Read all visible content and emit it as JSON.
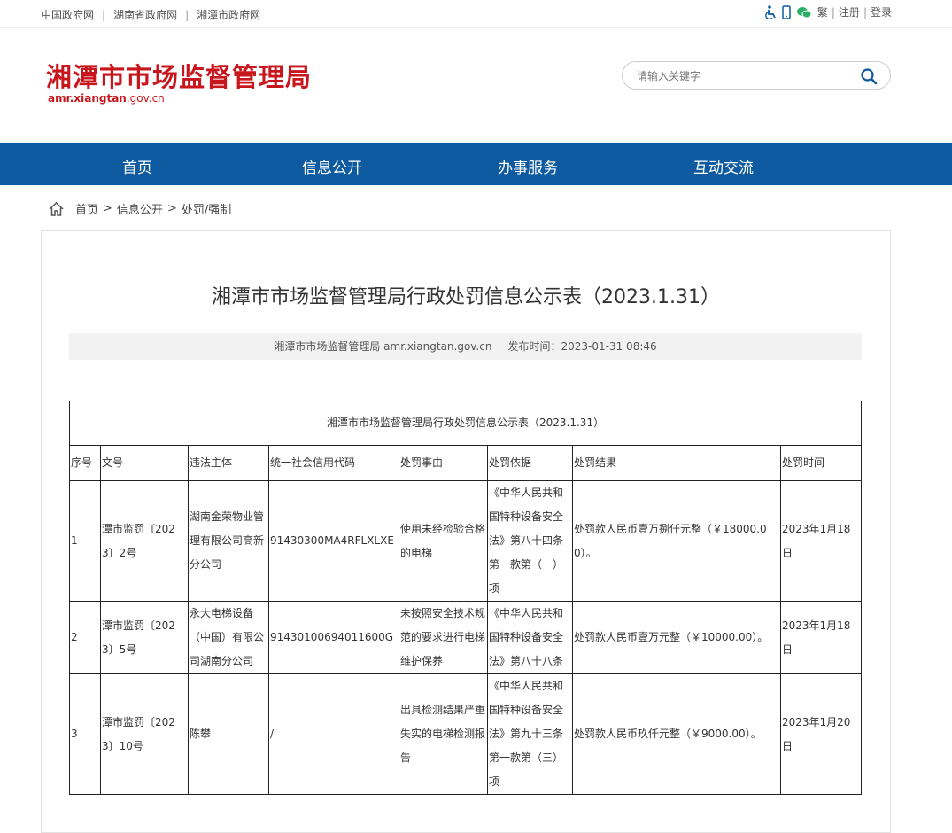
{
  "topbar": {
    "links": [
      "中国政府网",
      "湖南省政府网",
      "湘潭市政府网"
    ],
    "sep": "|",
    "right": [
      "繁",
      "注册",
      "登录"
    ]
  },
  "header": {
    "title": "湘潭市市场监督管理局",
    "domain_bold": "amr.xiangtan",
    "domain_rest": ".gov.cn",
    "search_placeholder": "请输入关键字"
  },
  "nav": [
    "首页",
    "信息公开",
    "办事服务",
    "互动交流"
  ],
  "breadcrumb": [
    "首页",
    "信息公开",
    "处罚/强制"
  ],
  "article": {
    "title": "湘潭市市场监督管理局行政处罚信息公示表（2023.1.31）",
    "source": "湘潭市市场监督管理局 amr.xiangtan.gov.cn",
    "published": "发布时间：2023-01-31 08:46"
  },
  "table": {
    "caption": "湘潭市市场监督管理局行政处罚信息公示表（2023.1.31）",
    "headers": [
      "序号",
      "文号",
      "违法主体",
      "统一社会信用代码",
      "处罚事由",
      "处罚依据",
      "处罚结果",
      "处罚时间"
    ],
    "rows": [
      [
        "1",
        "潭市监罚〔2023〕2号",
        "湖南金荣物业管理有限公司高新分公司",
        "91430300MA4RFLXLXE",
        "使用未经检验合格的电梯",
        "《中华人民共和国特种设备安全法》第八十四条第一款第（一）项",
        "处罚款人民币壹万捌仟元整（￥18000.00）。",
        "2023年1月18日"
      ],
      [
        "2",
        "潭市监罚〔2023〕5号",
        "永大电梯设备（中国）有限公司湖南分公司",
        "914301006940116​00G",
        "未按照安全技术规范的要求进行电梯维护保养",
        "《中华人民共和国特种设备安全法》第八十八条",
        "处罚款人民币壹万元整（￥10000.00）。",
        "2023年1月18日"
      ],
      [
        "3",
        "潭市监罚〔2023〕10号",
        "陈攀",
        "/",
        "出具检测结果严重失实的电梯检测报告",
        "《中华人民共和国特种设备安全法》第九十三条第一款第（三）项",
        "处罚款人民币玖仟元整（￥9000.00）。",
        "2023年1月20日"
      ]
    ]
  },
  "colors": {
    "brand_red": "#c8161d",
    "nav_blue": "#0d5aa0"
  }
}
